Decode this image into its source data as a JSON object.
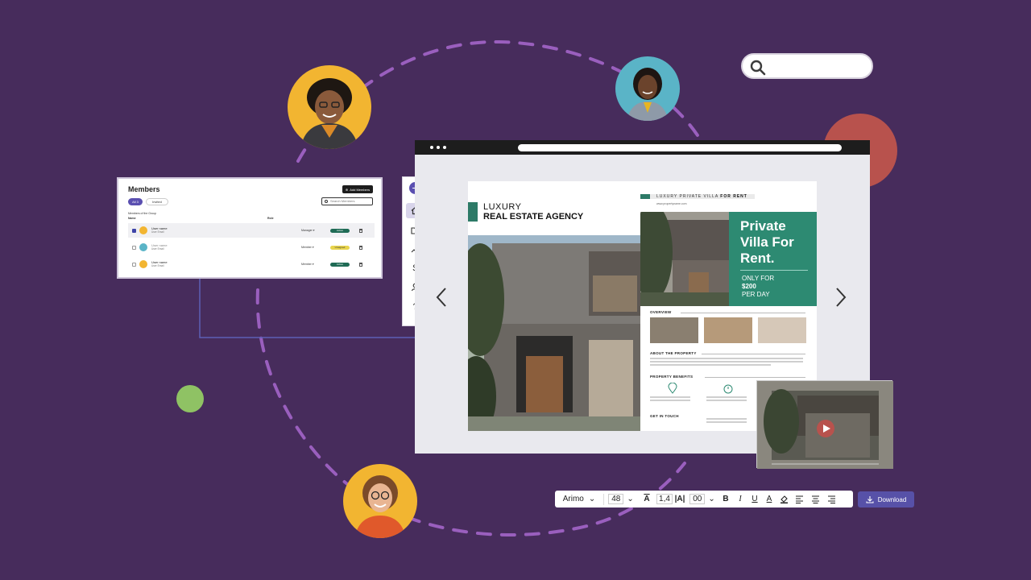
{
  "colors": {
    "background": "#472c5c",
    "accent": "#5a4fb0",
    "brand_green": "#2d8a72",
    "dashed_path": "#9a5fbe",
    "connector": "#5d5fb5"
  },
  "search": {
    "placeholder": ""
  },
  "members_panel": {
    "title": "Members",
    "add_button_label": "Add Members",
    "tabs": [
      {
        "label": "All 3",
        "active": true
      },
      {
        "label": "Invited",
        "active": false
      }
    ],
    "search_placeholder": "Search Members",
    "group_label": "Members of the Group",
    "columns": [
      "Name",
      "Role"
    ],
    "rows": [
      {
        "name": "User name",
        "email": "User Email",
        "role": "Manager",
        "status": "Active",
        "checked": true,
        "status_color": "#1f6b55"
      },
      {
        "name": "User name",
        "email": "User Email",
        "role": "Member",
        "status": "Unsigned",
        "checked": false,
        "status_color": "#e8d44d"
      },
      {
        "name": "User name",
        "email": "User Email",
        "role": "Member",
        "status": "Active",
        "checked": false,
        "status_color": "#1f6b55"
      }
    ]
  },
  "side_toolbar": {
    "items": [
      {
        "icon": "plus-icon"
      },
      {
        "icon": "home-icon",
        "active": true
      },
      {
        "icon": "folder-icon"
      },
      {
        "icon": "trend-icon"
      },
      {
        "icon": "dollar-icon",
        "glyph": "$"
      },
      {
        "icon": "user-icon"
      },
      {
        "icon": "help-icon",
        "glyph": "?"
      }
    ]
  },
  "brochure": {
    "left": {
      "line1": "LUXURY",
      "line2": "REAL ESTATE AGENCY"
    },
    "right": {
      "header_plain": "LUXURY PRIVATE VILLA",
      "header_bold": "FOR RENT",
      "website": "www.propertyname.com",
      "headline": "Private Villa For Rent.",
      "only_for": "ONLY FOR",
      "price": "$200",
      "per_day": "PER DAY",
      "sections": [
        "OVERVIEW",
        "ABOUT THE PROPERTY",
        "PROPERTY BENEFITS",
        "GET IN TOUCH"
      ]
    }
  },
  "format_toolbar": {
    "font": "Arimo",
    "font_size": "48",
    "line_height": "1,4",
    "letter_spacing": "00",
    "buttons": [
      "B",
      "I",
      "U"
    ]
  },
  "download_button": {
    "label": "Download"
  }
}
